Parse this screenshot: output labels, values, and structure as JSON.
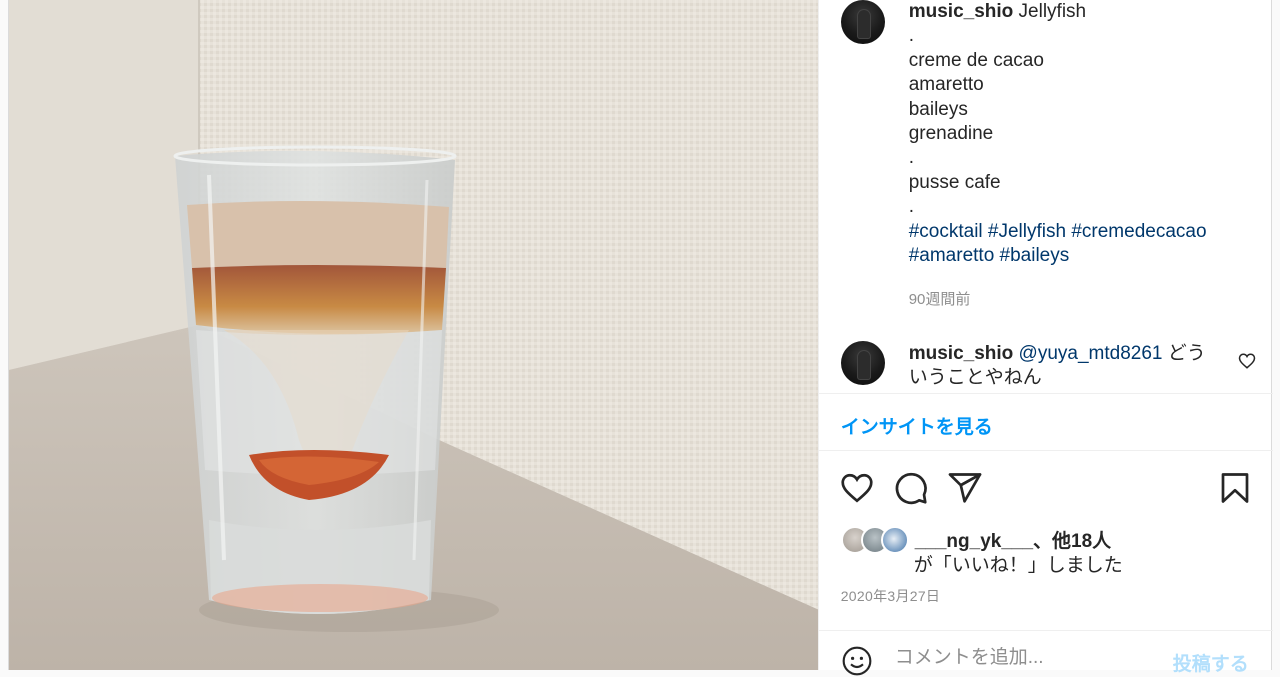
{
  "image": {
    "description": "",
    "colors": {
      "wall": "#e8e3da",
      "table": "#cfc7bd",
      "baileys": "#d9c2ad",
      "amaretto": "#b56a36",
      "grenadine": "#c0502a"
    }
  },
  "caption": {
    "username": "music_shio",
    "title": "Jellyfish",
    "lines": [
      ".",
      "creme de cacao",
      "amaretto",
      "baileys",
      "grenadine",
      ".",
      "pusse cafe",
      "."
    ],
    "hashtags_line1": "#cocktail #Jellyfish #cremedecacao",
    "hashtags_line2": "#amaretto #baileys",
    "time_ago": "90週間前"
  },
  "comment": {
    "username": "music_shio",
    "mention": "@yuya_mtd8261",
    "text_part1": " どう",
    "text_part2": "いうことやねん",
    "like_icon": "heart-outline-icon"
  },
  "insights": {
    "label": "インサイトを見る"
  },
  "actions": {
    "like_icon": "heart-icon",
    "comment_icon": "comment-icon",
    "share_icon": "paper-plane-icon",
    "save_icon": "bookmark-icon"
  },
  "likes": {
    "first_user": "___ng_yk___",
    "others": "、他18人",
    "suffix": "が「いいね！」しました"
  },
  "date": "2020年3月27日",
  "add_comment": {
    "emoji_icon": "smile-icon",
    "placeholder": "コメントを追加...",
    "post_label": "投稿する"
  }
}
